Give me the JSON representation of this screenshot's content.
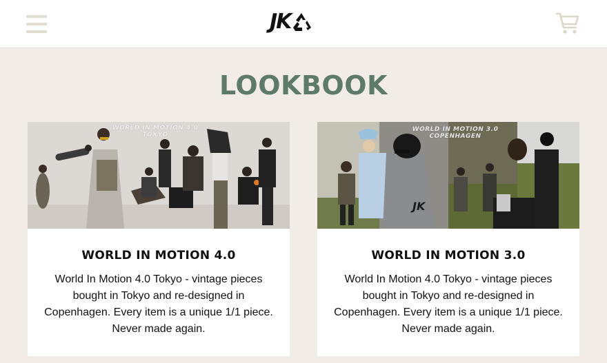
{
  "header": {
    "menu_icon": "hamburger-menu-icon",
    "logo_text": "JK",
    "logo_icon": "recycle-icon",
    "cart_icon": "shopping-cart-icon"
  },
  "page": {
    "title": "LOOKBOOK"
  },
  "cards": [
    {
      "image_caption_line1": "WORLD IN MOTION 4.0",
      "image_caption_line2": "TOKYO",
      "title": "WORLD IN MOTION 4.0",
      "description": "World In Motion 4.0 Tokyo - vintage pieces bought in Tokyo and re-designed in Copenhagen. Every item is a unique 1/1 piece. Never made again."
    },
    {
      "image_caption_line1": "WORLD IN MOTION 3.0",
      "image_caption_line2": "COPENHAGEN",
      "image_jacket_logo": "JK",
      "title": "WORLD IN MOTION 3.0",
      "description": "World In Motion 4.0 Tokyo - vintage pieces bought in Tokyo and re-designed in Copenhagen. Every item is a unique 1/1 piece. Never made again."
    }
  ],
  "colors": {
    "background": "#f1ece6",
    "header": "#ffffff",
    "title_green": "#5e7a6a",
    "menu_icon": "#e2ddd1",
    "cart_icon": "#dcd7c9"
  }
}
